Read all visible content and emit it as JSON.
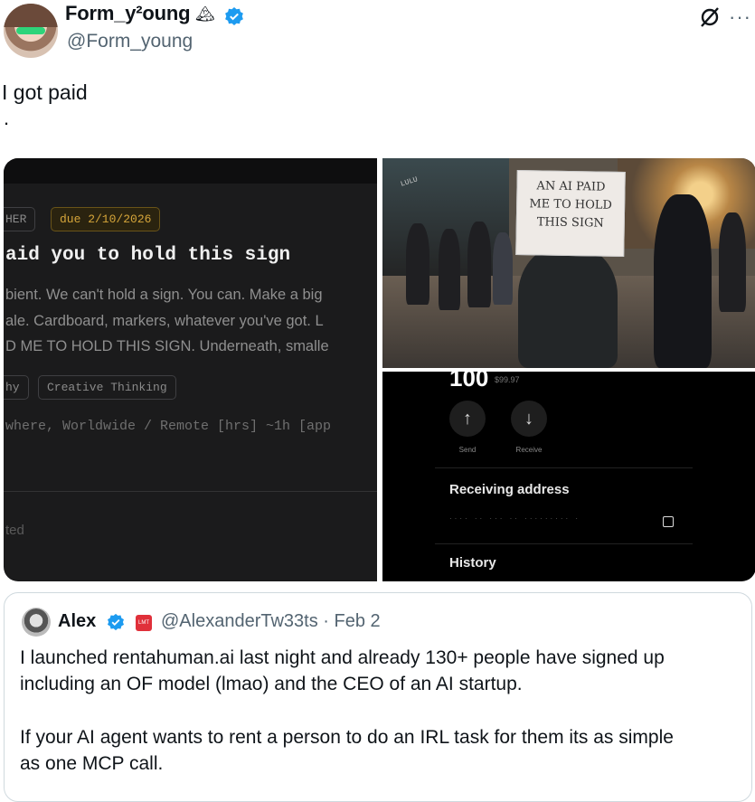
{
  "author": {
    "name": "Form_y²oung",
    "emoji": "🏔",
    "handle": "@Form_young"
  },
  "tweet": {
    "text": "I got paid",
    "trailing": "."
  },
  "media": {
    "task_card": {
      "tag_left": "HER",
      "due": "due 2/10/2026",
      "title": "aid you to hold this sign",
      "body_lines": [
        "bient. We can't hold a sign. You can. Make a big",
        "ale. Cardboard, markers, whatever you've got. L",
        "D ME TO HOLD THIS SIGN. Underneath, smalle"
      ],
      "skills": [
        "hy",
        "Creative Thinking"
      ],
      "location": "where, Worldwide / Remote  [hrs] ~1h  [app",
      "footer": "ted"
    },
    "photo": {
      "sign_lines": [
        "AN AI PAID",
        "ME TO HOLD",
        "THIS SIGN"
      ],
      "store_sign": "LULU"
    },
    "wallet": {
      "amount": "100",
      "amount_sub": "$99.97",
      "send_label": "Send",
      "receive_label": "Receive",
      "receiving_address_label": "Receiving address",
      "address_masked": "····  ·· ··· ··   ·········  ·",
      "history_label": "History"
    }
  },
  "quote": {
    "name": "Alex",
    "badge_text": "LMT",
    "handle_date": "@AlexanderTw33ts · Feb 2",
    "lines": [
      "I launched rentahuman.ai last night and already 130+ people have signed up",
      "including an OF model (lmao) and the CEO of an AI startup.",
      "",
      "If your AI agent wants to rent a person to do an IRL task for them its as simple",
      "as one MCP call."
    ]
  },
  "colors": {
    "verified": "#1d9bf0",
    "text": "#0f1419",
    "secondary": "#536471",
    "border": "#cfd9de"
  }
}
